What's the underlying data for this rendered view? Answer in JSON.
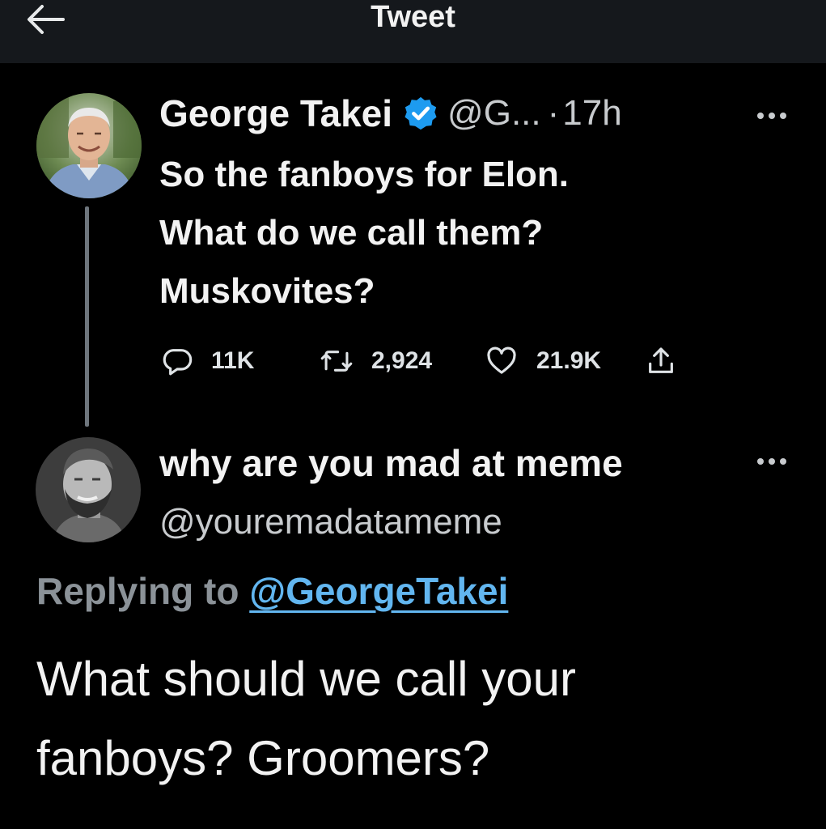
{
  "header": {
    "title": "Tweet",
    "back_icon": "arrow-left-icon"
  },
  "tweet": {
    "author_name": "George Takei",
    "verified_icon": "verified-badge-icon",
    "handle_truncated": "@G...",
    "separator": "·",
    "time": "17h",
    "text_lines": [
      "So the fanboys for Elon.",
      "What do we call them?",
      "Muskovites?"
    ],
    "stats": {
      "replies": "11K",
      "retweets": "2,924",
      "likes": "21.9K"
    },
    "icons": [
      "reply-icon",
      "retweet-icon",
      "like-icon",
      "share-icon"
    ]
  },
  "reply": {
    "author_name": "why are you mad at meme",
    "handle": "@youremadatameme",
    "replying_prefix": "Replying to",
    "replying_to": "@GeorgeTakei",
    "text_lines": [
      "What should we call your",
      "fanboys? Groomers?"
    ]
  },
  "colors": {
    "background": "#000000",
    "header_bg": "#15181c",
    "link": "#62b6f0",
    "verified": "#1d9bf0",
    "muted": "#8b9298"
  }
}
